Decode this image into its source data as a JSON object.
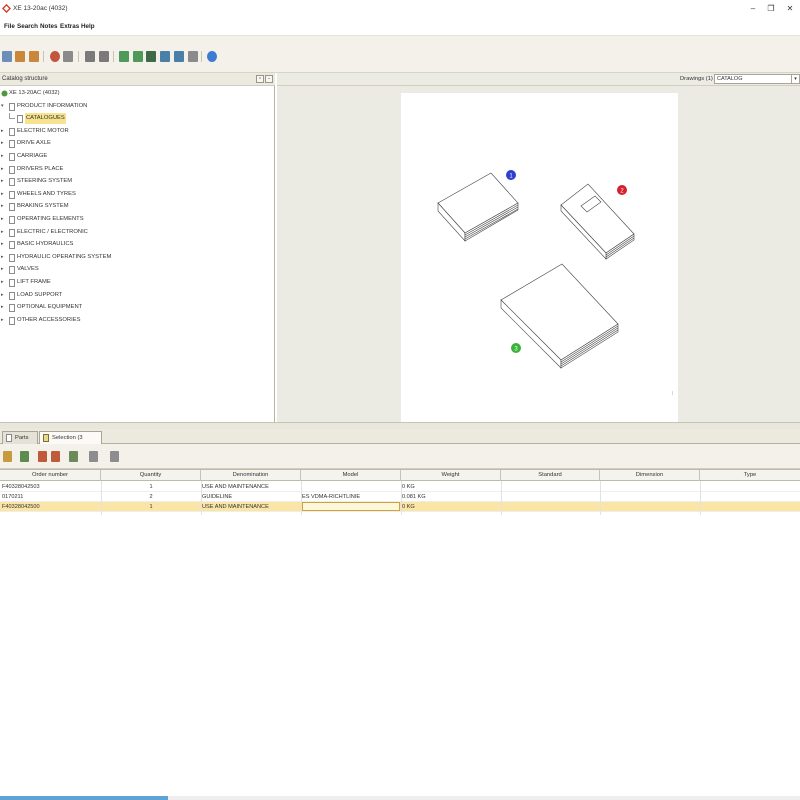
{
  "window": {
    "title": "XE 13-20ac (4032)",
    "controls": {
      "minimize": "–",
      "maximize": "❐",
      "close": "✕"
    }
  },
  "menu": [
    "File",
    "Search",
    "Notes",
    "Extras",
    "Help"
  ],
  "tree": {
    "title": "Catalog structure",
    "root": "XE 13-20AC (4032)",
    "items": [
      {
        "label": "PRODUCT INFORMATION",
        "expanded": true
      },
      {
        "label": "CATALOGUES",
        "child": true,
        "selected": true
      },
      {
        "label": "ELECTRIC MOTOR"
      },
      {
        "label": "DRIVE AXLE"
      },
      {
        "label": "CARRIAGE"
      },
      {
        "label": "DRIVERS PLACE"
      },
      {
        "label": "STEERING SYSTEM"
      },
      {
        "label": "WHEELS AND TYRES"
      },
      {
        "label": "BRAKING SYSTEM"
      },
      {
        "label": "OPERATING ELEMENTS"
      },
      {
        "label": "ELECTRIC / ELECTRONIC"
      },
      {
        "label": "BASIC HYDRAULICS"
      },
      {
        "label": "HYDRAULIC OPERATING SYSTEM"
      },
      {
        "label": "VALVES"
      },
      {
        "label": "LIFT FRAME"
      },
      {
        "label": "LOAD SUPPORT"
      },
      {
        "label": "OPTIONAL EQUIPMENT"
      },
      {
        "label": "OTHER ACCESSORIES"
      }
    ]
  },
  "drawing": {
    "label": "Drawings (1)",
    "selected": "CATALOG",
    "callouts": [
      {
        "num": "1",
        "color": "#2c3fd0"
      },
      {
        "num": "2",
        "color": "#d61f2f"
      },
      {
        "num": "3",
        "color": "#3bb23b"
      }
    ],
    "scale_text": "—"
  },
  "tabs": [
    {
      "label": "Parts list",
      "active": false
    },
    {
      "label": "Selection (3 Entries)",
      "active": true
    }
  ],
  "table": {
    "columns": [
      "Order number",
      "Quantity",
      "Denomination",
      "Model",
      "Weight",
      "Standard",
      "Dimension",
      "Type"
    ],
    "rows": [
      [
        "F40328042503",
        "1",
        "USE AND MAINTENANCE",
        "",
        "0 KG",
        "",
        "",
        ""
      ],
      [
        "0170211",
        "2",
        "GUIDELINE",
        "ES VDMA-RICHTLINIE",
        "0.081 KG",
        "",
        "",
        ""
      ],
      [
        "F40328042500",
        "1",
        "USE AND MAINTENANCE",
        "",
        "0 KG",
        "",
        "",
        ""
      ]
    ],
    "selected_row": 2
  },
  "status": {
    "progress": 0.21,
    "progress_color": "#5fa3d6"
  },
  "colors": {
    "selection": "#fbe5a6",
    "tree_highlight": "#f7e38e",
    "panel": "#ecebe3"
  }
}
